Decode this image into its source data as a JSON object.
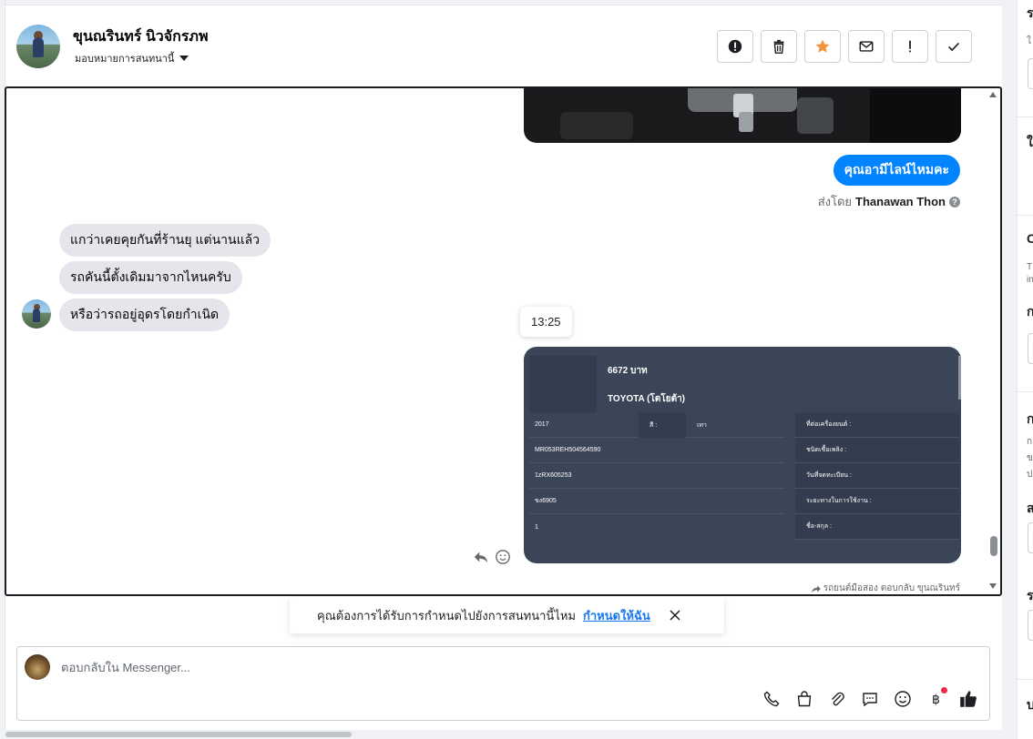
{
  "header": {
    "contact_name": "ขุนณรินทร์ นิวจักรภพ",
    "assign_label": "มอบหมายการสนทนานี้",
    "actions": [
      {
        "name": "report-button",
        "icon": "exclamation-circle-icon"
      },
      {
        "name": "delete-button",
        "icon": "trash-icon"
      },
      {
        "name": "star-button",
        "icon": "star-icon"
      },
      {
        "name": "mark-unread-button",
        "icon": "envelope-icon"
      },
      {
        "name": "follow-up-button",
        "icon": "exclamation-icon"
      },
      {
        "name": "mark-done-button",
        "icon": "check-icon"
      }
    ]
  },
  "messages": {
    "outgoing_text": "คุณอามีไลน์ไหมคะ",
    "sent_by_prefix": "ส่งโดย",
    "sent_by_name": "Thanawan Thon",
    "incoming": [
      "แกว่าเคยคุยกันที่ร้านยุ แต่นานแล้ว",
      "รถคันนี้ตั้งเดิมมาจากไหนครับ",
      "หรือว่ารถอยู่อุดรโดยกำเนิด"
    ],
    "time_tooltip": "13:25"
  },
  "card": {
    "price": "6672 บาท",
    "brand": "TOYOTA (โตโยต้า)",
    "left_rows": [
      "2017",
      "MR053REH504564590",
      "1zRX605253",
      "ขง6905",
      "1"
    ],
    "color_label": "สี :",
    "color_value": "เทา",
    "right_rows": [
      "ที่ต่อเครื่องยนต์ :",
      "ชนิดเชื้อเพลิง :",
      "วันที่จดทะเบียน :",
      "ระยะทางในการใช้งาน :",
      "ชื่อ-สกุล :"
    ]
  },
  "footnote": "รถยนต์มือสอง ตอบกลับ ขุนณรินทร์",
  "banner": {
    "text": "คุณต้องการได้รับการกำหนดไปยังการสนทนานี้ไหม",
    "link": "กำหนดให้ฉัน"
  },
  "composer": {
    "placeholder": "ตอบกลับใน Messenger..."
  },
  "right_panel": {
    "letters": [
      "ร",
      "ใ",
      "ป",
      "ใ",
      "C",
      "ก",
      "ก",
      "ส",
      "ร",
      "บ"
    ],
    "small": [
      "T",
      "in",
      "ก",
      "ข",
      "ป"
    ]
  },
  "colors": {
    "accent": "#0084ff",
    "star": "#f7923b",
    "card_bg": "#3b4558",
    "link": "#1877f2"
  }
}
